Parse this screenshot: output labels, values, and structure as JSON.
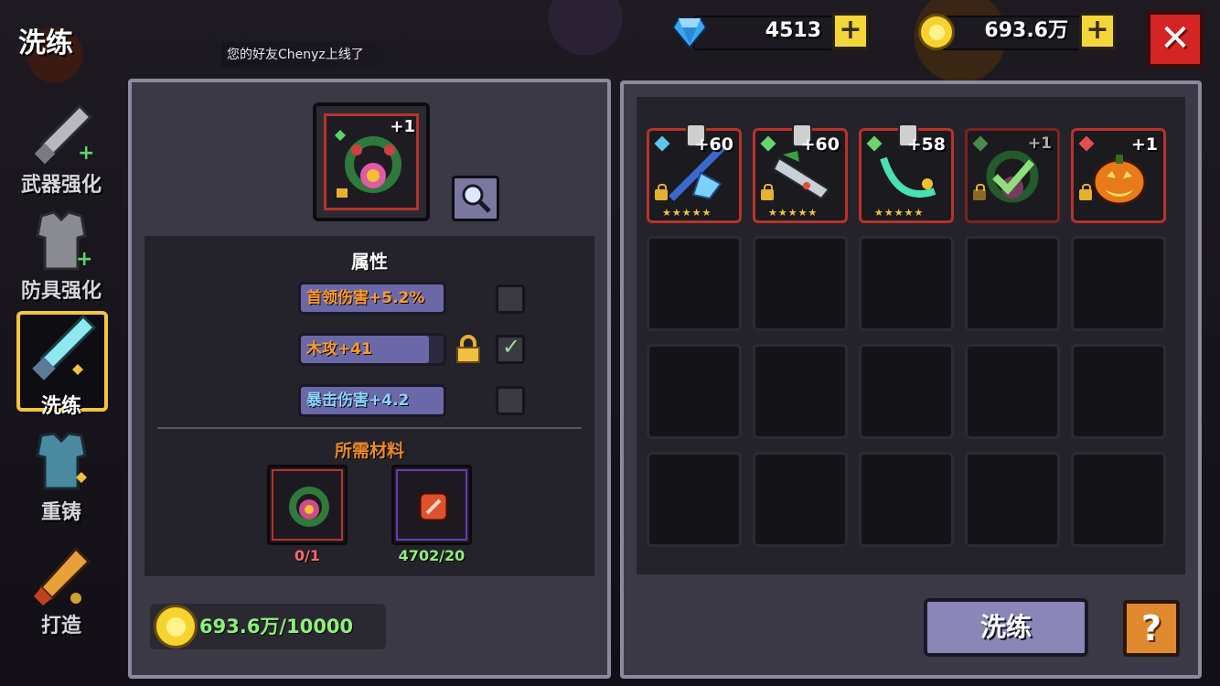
{
  "header": {
    "title": "洗练",
    "toast": "您的好友Chenyz上线了",
    "gems": "4513",
    "gold": "693.6万",
    "plus_label": "+",
    "close_label": "✕"
  },
  "sidebar": {
    "items": [
      {
        "label": "武器强化",
        "icon": "sword-upgrade-icon"
      },
      {
        "label": "防具强化",
        "icon": "armor-upgrade-icon"
      },
      {
        "label": "洗练",
        "icon": "ice-sword-refine-icon",
        "active": true
      },
      {
        "label": "重铸",
        "icon": "armor-recast-icon"
      },
      {
        "label": "打造",
        "icon": "forge-rocket-icon"
      }
    ]
  },
  "refine_panel": {
    "item_level": "+1",
    "attributes_title": "属性",
    "attributes": [
      {
        "text": "首领伤害+5.2%",
        "color": "orange",
        "fill": 1.0,
        "locked": false,
        "checked": false
      },
      {
        "text": "木攻+41",
        "color": "orange",
        "fill": 0.9,
        "locked": true,
        "checked": true
      },
      {
        "text": "暴击伤害+4.2",
        "color": "blue",
        "fill": 1.0,
        "locked": false,
        "checked": false
      }
    ],
    "materials_title": "所需材料",
    "materials": [
      {
        "name": "flower-wreath-material",
        "count": "0/1",
        "count_color": "#ff6a6a"
      },
      {
        "name": "red-gem-material",
        "count": "4702/20",
        "count_color": "#8ef07a"
      }
    ],
    "gold_cost": "693.6万/10000"
  },
  "inventory": {
    "items": [
      {
        "level": "+60",
        "gem_color": "#5ac8f0",
        "stars": "★★★★★",
        "icon": "ice-spear-icon"
      },
      {
        "level": "+60",
        "gem_color": "#6ad66a",
        "stars": "★★★★★",
        "icon": "gun-icon"
      },
      {
        "level": "+58",
        "gem_color": "#6ad66a",
        "stars": "★★★★★",
        "icon": "green-blade-icon"
      },
      {
        "level": "+1",
        "gem_color": "#4a8a4a",
        "stars": "",
        "icon": "wreath-selected-icon"
      },
      {
        "level": "+1",
        "gem_color": "#e05050",
        "stars": "",
        "icon": "pumpkin-icon"
      }
    ]
  },
  "actions": {
    "refine_button": "洗练",
    "help_button": "?"
  }
}
